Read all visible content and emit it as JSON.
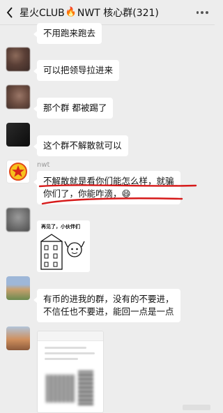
{
  "header": {
    "back_icon": "chevron-left-icon",
    "title_left": "星火CLUB",
    "fire_glyph": "🔥",
    "title_right": "NWT 核心群(321)",
    "more_icon": "more-dots-icon"
  },
  "messages": [
    {
      "text": "不用跑来跑去"
    },
    {
      "text": "可以把领导拉进来"
    },
    {
      "text": "那个群 都被踢了"
    },
    {
      "text": "这个群不解散就可以"
    },
    {
      "nickname": "nwt",
      "line1": "不解散就是看你们能怎么样，就骗",
      "line2": "你们了，你能咋滴，",
      "emoji": "😄"
    },
    {
      "sticker_caption": "再见了，小伙伴们"
    },
    {
      "line1": "有币的进我的群，没有的不要进，",
      "line2": "不信任也不要进，能回一点是一点"
    }
  ],
  "colors": {
    "background": "#ededed",
    "bubble": "#ffffff",
    "annotation_red": "#d61a1a"
  }
}
